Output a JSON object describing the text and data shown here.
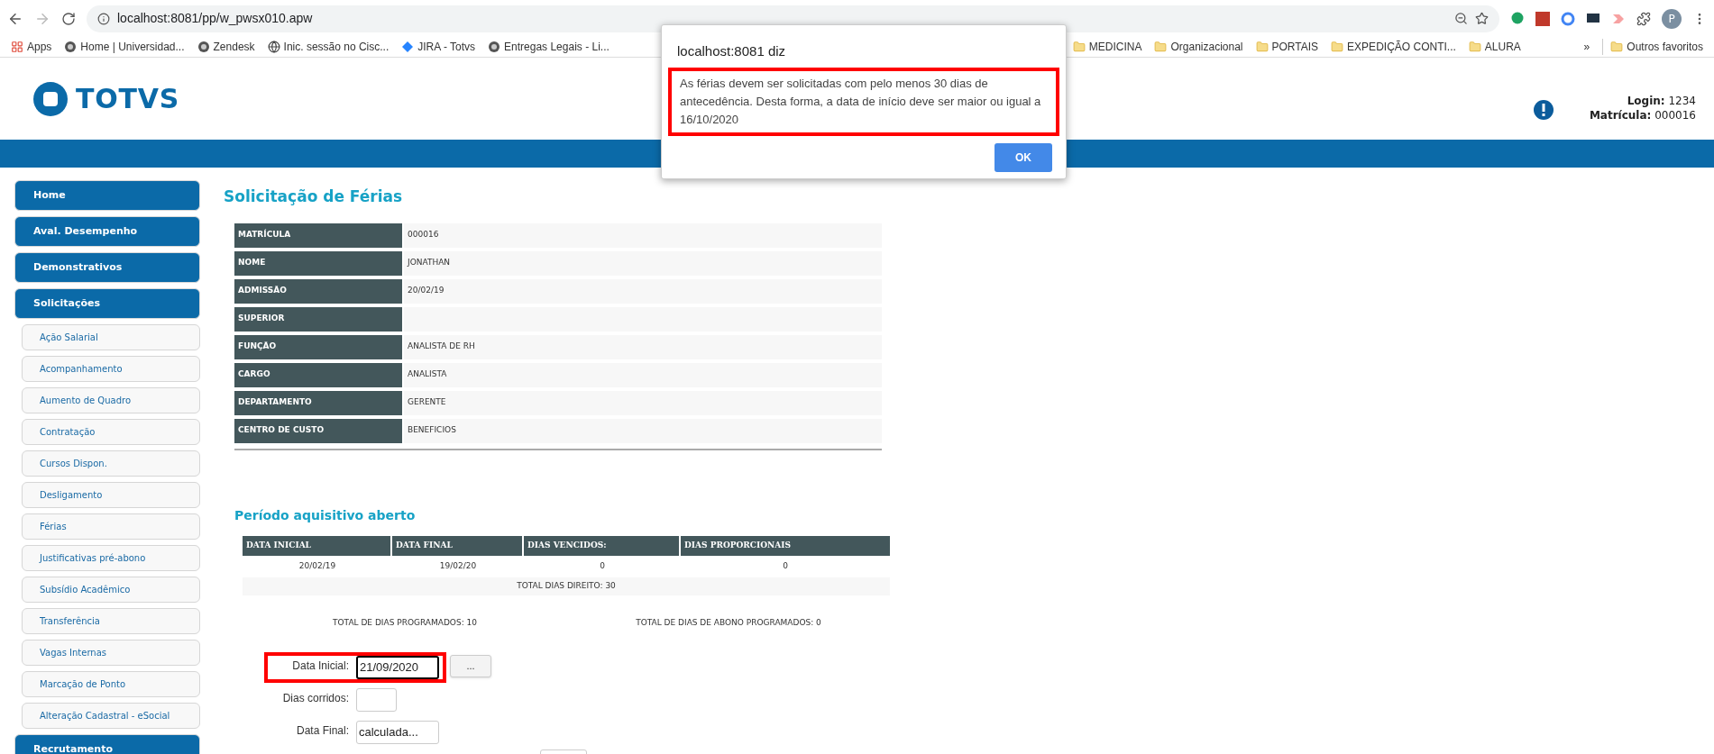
{
  "browser": {
    "url": "localhost:8081/pp/w_pwsx010.apw",
    "bookmarks": [
      {
        "label": "Apps",
        "kind": "apps"
      },
      {
        "label": "Home | Universidad...",
        "kind": "site"
      },
      {
        "label": "Zendesk",
        "kind": "site"
      },
      {
        "label": "Inic. sessão no Cisc...",
        "kind": "globe"
      },
      {
        "label": "JIRA - Totvs",
        "kind": "jira"
      },
      {
        "label": "Entregas Legais - Li...",
        "kind": "site"
      },
      {
        "label": "MEDICINA",
        "kind": "folder"
      },
      {
        "label": "Organizacional",
        "kind": "folder"
      },
      {
        "label": "PORTAIS",
        "kind": "folder"
      },
      {
        "label": "EXPEDIÇÃO CONTI...",
        "kind": "folder"
      },
      {
        "label": "ALURA",
        "kind": "folder"
      }
    ],
    "overflow": "»",
    "other": "Outros favoritos",
    "profile": "P"
  },
  "header": {
    "logo": "TOTVS",
    "login_label": "Login:",
    "login": "1234",
    "matricula_label": "Matrícula:",
    "matricula": "000016"
  },
  "sidebar": [
    {
      "label": "Home"
    },
    {
      "label": "Aval. Desempenho"
    },
    {
      "label": "Demonstrativos"
    },
    {
      "label": "Solicitações",
      "children": [
        {
          "label": "Ação Salarial"
        },
        {
          "label": "Acompanhamento"
        },
        {
          "label": "Aumento de Quadro"
        },
        {
          "label": "Contratação"
        },
        {
          "label": "Cursos Dispon."
        },
        {
          "label": "Desligamento"
        },
        {
          "label": "Férias"
        },
        {
          "label": "Justificativas pré-abono"
        },
        {
          "label": "Subsídio Acadêmico"
        },
        {
          "label": "Transferência"
        },
        {
          "label": "Vagas Internas"
        },
        {
          "label": "Marcação de Ponto"
        },
        {
          "label": "Alteração Cadastral - eSocial"
        }
      ]
    },
    {
      "label": "Recrutamento"
    }
  ],
  "page_title": "Solicitação de Férias",
  "employee": [
    {
      "label": "MATRÍCULA",
      "value": "000016"
    },
    {
      "label": "NOME",
      "value": "JONATHAN"
    },
    {
      "label": "ADMISSÃO",
      "value": "20/02/19"
    },
    {
      "label": "SUPERIOR"
    },
    {
      "label": "FUNÇÃO",
      "value": "ANALISTA DE RH"
    },
    {
      "label": "CARGO",
      "value": "ANALISTA"
    },
    {
      "label": "DEPARTAMENTO",
      "value": "GERENTE"
    },
    {
      "label": "CENTRO DE CUSTO",
      "value": "BENEFICIOS"
    }
  ],
  "period": {
    "title": "Período aquisitivo aberto",
    "columns": [
      "DATA INICIAL",
      "DATA FINAL",
      "DIAS VENCIDOS:",
      "DIAS PROPORCIONAIS"
    ],
    "row": [
      "20/02/19",
      "19/02/20",
      "0",
      "0"
    ],
    "total": "TOTAL DIAS DIREITO: 30",
    "programados": "TOTAL DE DIAS PROGRAMADOS: 10",
    "abono": "TOTAL DE DIAS DE ABONO PROGRAMADOS: 0"
  },
  "form": [
    {
      "label": "Data Inicial:",
      "value": "21/09/2020",
      "focused": true,
      "highlighted": true,
      "picker": "..."
    },
    {
      "label": "Dias corridos:",
      "focused": false
    },
    {
      "label": "Data Final:",
      "value": "calculada...",
      "focused": false
    }
  ],
  "dialog": {
    "title": "localhost:8081 diz",
    "message": "As férias devem ser solicitadas com pelo menos 30 dias de antecedência. Desta forma, a data de início deve ser maior ou igual a 16/10/2020",
    "highlighted": true,
    "button": "OK"
  }
}
